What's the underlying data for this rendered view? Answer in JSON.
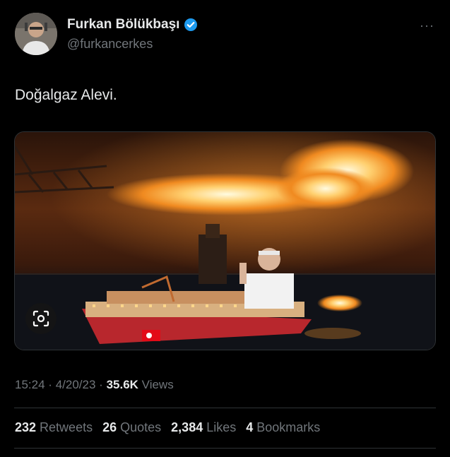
{
  "author": {
    "display_name": "Furkan Bölükbaşı",
    "handle": "@furkancerkes",
    "verified_icon": "verified-badge-icon",
    "avatar_icon": "avatar"
  },
  "more_label": "···",
  "tweet": {
    "text": "Doğalgaz Alevi."
  },
  "media": {
    "scan_icon": "scan-icon"
  },
  "meta": {
    "time": "15:24",
    "sep1": "·",
    "date": "4/20/23",
    "sep2": "·",
    "views_count": "35.6K",
    "views_label": "Views"
  },
  "stats": {
    "retweets_count": "232",
    "retweets_label": "Retweets",
    "quotes_count": "26",
    "quotes_label": "Quotes",
    "likes_count": "2,384",
    "likes_label": "Likes",
    "bookmarks_count": "4",
    "bookmarks_label": "Bookmarks"
  },
  "colors": {
    "background": "#000000",
    "text_primary": "#e7e9ea",
    "text_secondary": "#71767b",
    "verified_blue": "#1d9bf0",
    "divider": "#2f3336"
  }
}
